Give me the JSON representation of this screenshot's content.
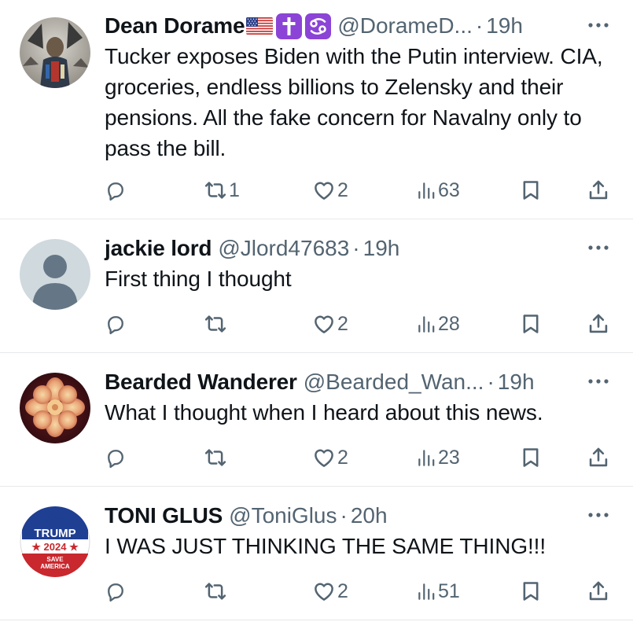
{
  "colors": {
    "text_primary": "#0f1419",
    "text_secondary": "#536471",
    "divider": "#e6e9eb",
    "badge_purple": "#8b44d6"
  },
  "posts": [
    {
      "name": "Dean Dorame",
      "badges": [
        "us-flag-icon",
        "latin-cross-icon",
        "cancer-zodiac-icon"
      ],
      "handle": "@DorameD...",
      "dot": "·",
      "time": "19h",
      "text": "Tucker exposes Biden with the Putin interview. CIA, groceries,  endless billions to Zelensky and their pensions.  All the fake concern for Navalny only to pass the bill.",
      "retweets": "1",
      "likes": "2",
      "views": "63"
    },
    {
      "name": "jackie lord",
      "handle": "@Jlord47683",
      "dot": "·",
      "time": "19h",
      "text": "First thing I thought",
      "retweets": "",
      "likes": "2",
      "views": "28"
    },
    {
      "name": "Bearded Wanderer",
      "handle": "@Bearded_Wan...",
      "dot": "·",
      "time": "19h",
      "text": "What I thought when I heard about this news.",
      "retweets": "",
      "likes": "2",
      "views": "23"
    },
    {
      "name": "TONI GLUS",
      "handle": "@ToniGlus",
      "dot": "·",
      "time": "20h",
      "text": "I WAS JUST THINKING THE SAME THING!!!",
      "retweets": "",
      "likes": "2",
      "views": "51",
      "avatar_logo": {
        "stars": "★★★",
        "line1": "TRUMP",
        "line2": "★ 2024 ★",
        "line3": "SAVE",
        "line4": "AMERICA"
      }
    }
  ]
}
